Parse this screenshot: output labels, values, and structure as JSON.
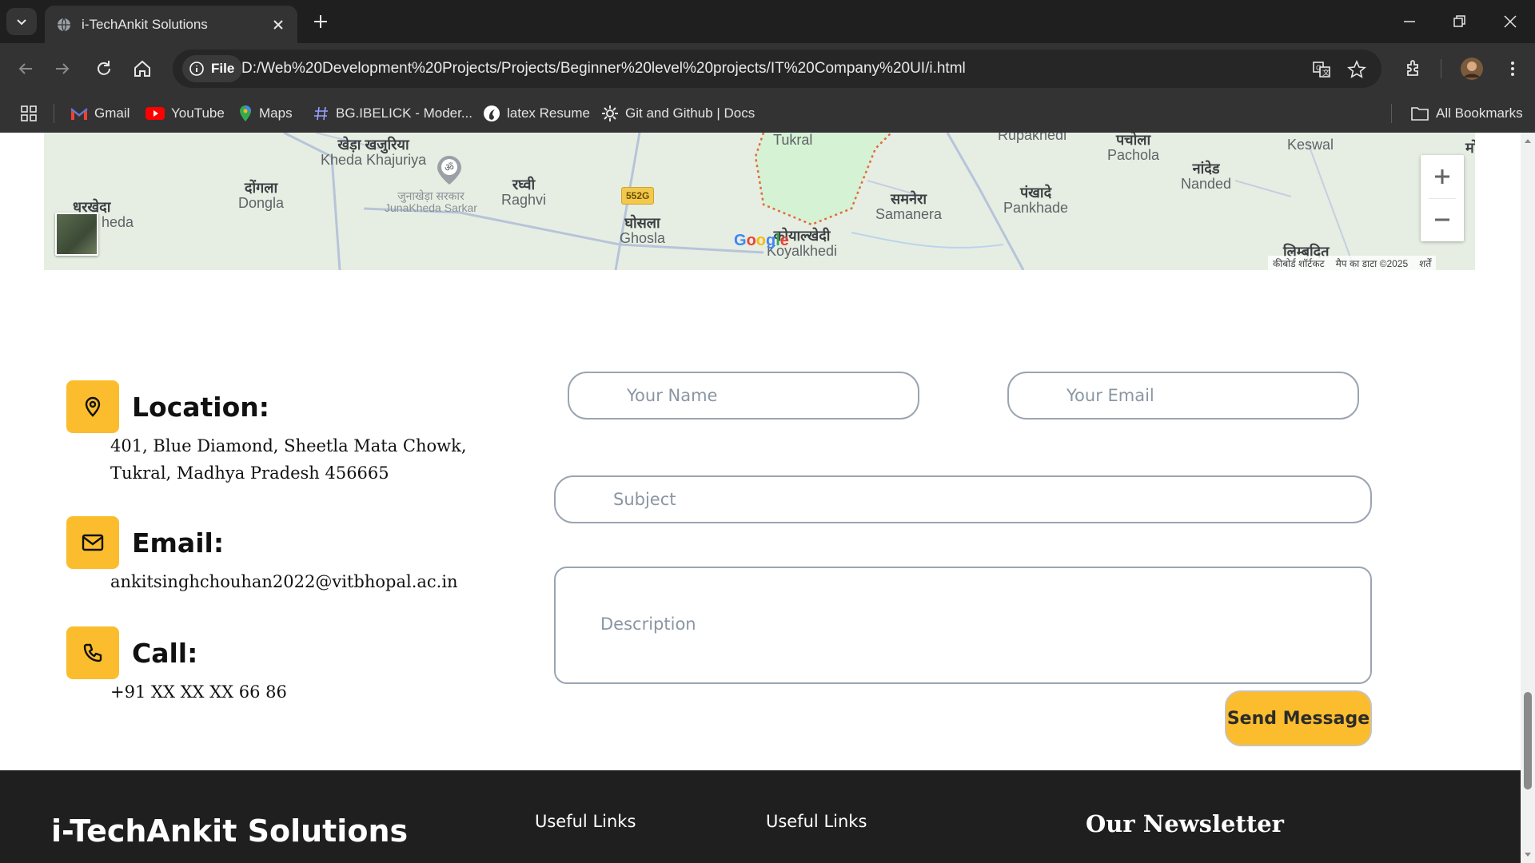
{
  "browser": {
    "tab_title": "i-TechAnkit Solutions",
    "site_chip": "File",
    "url": "D:/Web%20Development%20Projects/Projects/Beginner%20level%20projects/IT%20Company%20UI/i.html",
    "bookmarks": [
      {
        "label": "Gmail"
      },
      {
        "label": "YouTube"
      },
      {
        "label": "Maps"
      },
      {
        "label": "BG.IBELICK - Moder..."
      },
      {
        "label": "latex Resume"
      },
      {
        "label": "Git and Github | Docs"
      }
    ],
    "all_bookmarks": "All Bookmarks"
  },
  "map": {
    "places": [
      {
        "hi": "खेड़ा खजुरिया",
        "en": "Kheda Khajuriya"
      },
      {
        "hi": "दोंगला",
        "en": "Dongla"
      },
      {
        "hi": "धरखेदा",
        "en": "heda"
      },
      {
        "hi": "जुनाखेड़ा सरकार",
        "en": "JunaKheda Sarkar"
      },
      {
        "hi": "रघ्वी",
        "en": "Raghvi"
      },
      {
        "hi": "घोसला",
        "en": "Ghosla"
      },
      {
        "hi": "",
        "en": "Tukral"
      },
      {
        "hi": "कोयाल्खेदी",
        "en": "Koyalkhedi"
      },
      {
        "hi": "समनेरा",
        "en": "Samanera"
      },
      {
        "hi": "पंखादे",
        "en": "Pankhade"
      },
      {
        "hi": "पचोला",
        "en": "Pachola"
      },
      {
        "hi": "नांदेड",
        "en": "Nanded"
      },
      {
        "hi": "",
        "en": "Keswal"
      },
      {
        "hi": "",
        "en": "Rupakhedi"
      },
      {
        "hi": "लिम्बदित",
        "en": ""
      },
      {
        "hi": "मो",
        "en": ""
      }
    ],
    "road_label": "552G",
    "google": "Google",
    "footer": [
      "कीबोर्ड शॉर्टकट",
      "मैप का डाटा ©2025",
      "शर्तें"
    ]
  },
  "contact": {
    "location": {
      "title": "Location:",
      "lines": [
        "401, Blue Diamond, Sheetla Mata Chowk,",
        "Tukral, Madhya Pradesh 456665"
      ]
    },
    "email": {
      "title": "Email:",
      "value": "ankitsinghchouhan2022@vitbhopal.ac.in"
    },
    "call": {
      "title": "Call:",
      "value": "+91 XX XX XX 66 86"
    }
  },
  "form": {
    "name_placeholder": "Your Name",
    "email_placeholder": "Your Email",
    "subject_placeholder": "Subject",
    "description_placeholder": "Description",
    "send_label": "Send Message"
  },
  "footer": {
    "brand": "i-TechAnkit Solutions",
    "col1": "Useful Links",
    "col2": "Useful Links",
    "newsletter": "Our Newsletter"
  },
  "colors": {
    "accent": "#fbbd2d",
    "footer_bg": "#1f1f1f",
    "chrome_bg": "#333333"
  }
}
